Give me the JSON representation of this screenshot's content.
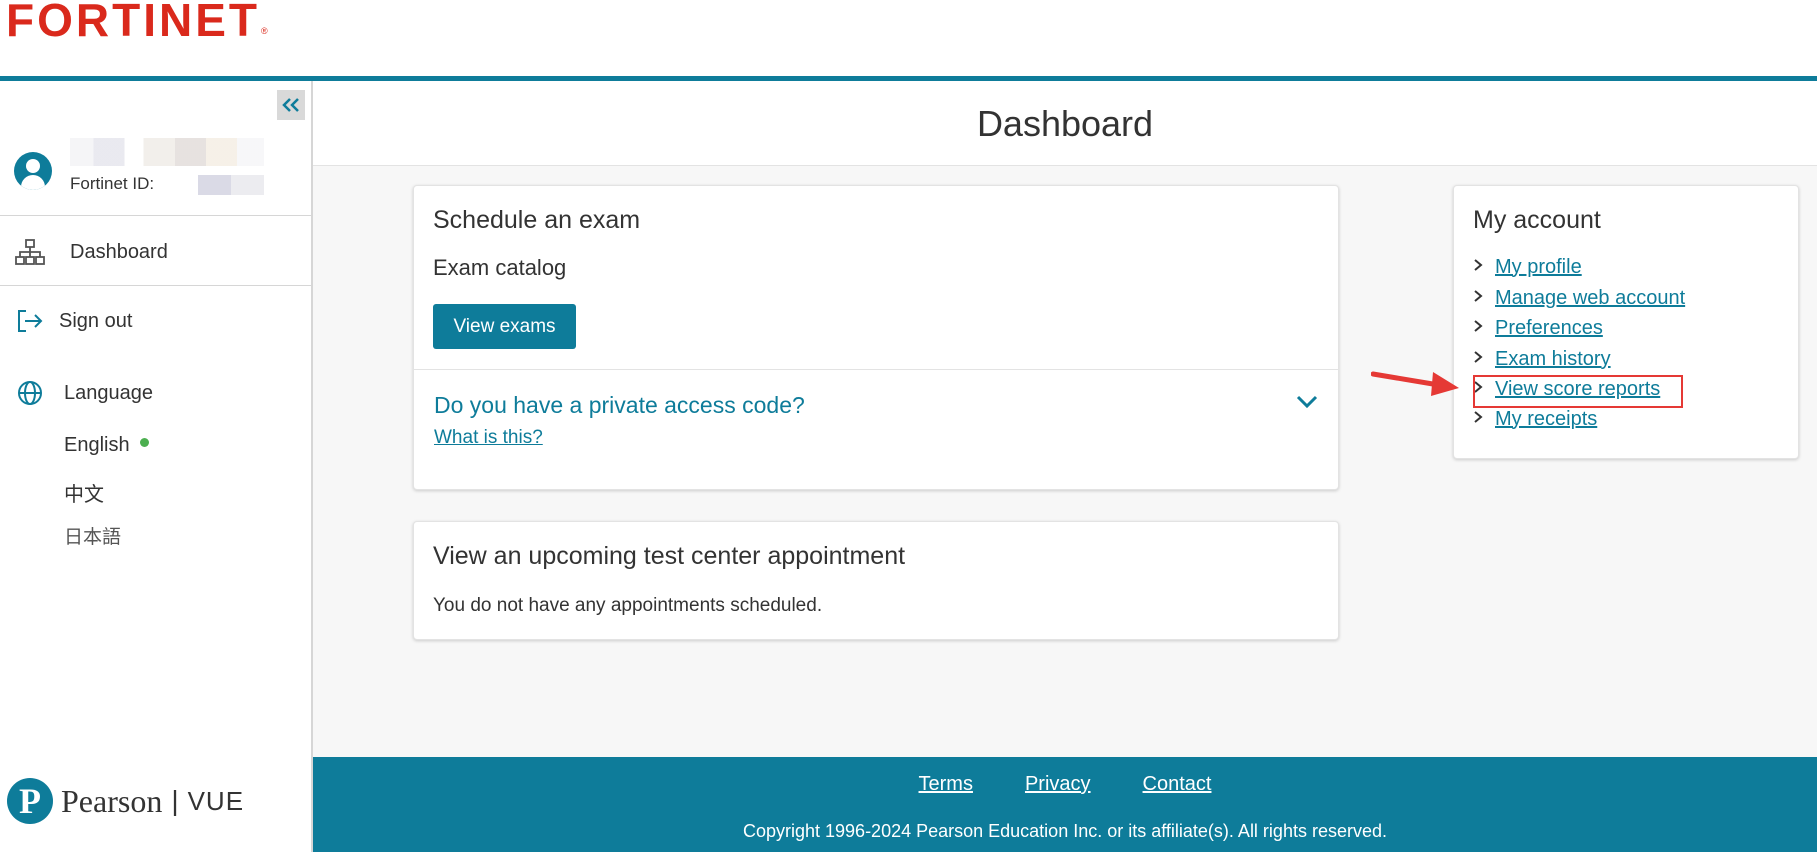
{
  "brand": {
    "logo_text": "FORTINET",
    "logo_mark": "®"
  },
  "sidebar": {
    "collapse_icon": "double-chevron-left-icon",
    "user": {
      "id_label": "Fortinet ID:"
    },
    "nav": [
      {
        "label": "Dashboard",
        "icon": "sitemap-icon"
      },
      {
        "label": "Sign out",
        "icon": "sign-out-icon"
      }
    ],
    "language": {
      "label": "Language",
      "icon": "globe-icon",
      "options": [
        "English",
        "中文",
        "日本語"
      ],
      "active": "English"
    },
    "footer_logo": {
      "mark": "P",
      "word": "Pearson",
      "separator": "|",
      "product": "VUE"
    }
  },
  "main": {
    "title": "Dashboard",
    "schedule": {
      "title": "Schedule an exam",
      "subtitle": "Exam catalog",
      "button": "View exams",
      "access_question": "Do you have a private access code?",
      "access_link": "What is this?"
    },
    "upcoming": {
      "title": "View an upcoming test center appointment",
      "message": "You do not have any appointments scheduled."
    },
    "account": {
      "title": "My account",
      "links": [
        "My profile",
        "Manage web account",
        "Preferences",
        "Exam history",
        "View score reports",
        "My receipts"
      ],
      "highlighted": "View score reports"
    }
  },
  "footer": {
    "links": [
      "Terms",
      "Privacy",
      "Contact"
    ],
    "copyright": "Copyright 1996-2024 Pearson Education Inc. or its affiliate(s). All rights reserved."
  },
  "colors": {
    "brand_red": "#da291c",
    "accent_teal": "#0e7c9a",
    "annotation_red": "#e53935",
    "active_green": "#4caf50"
  }
}
